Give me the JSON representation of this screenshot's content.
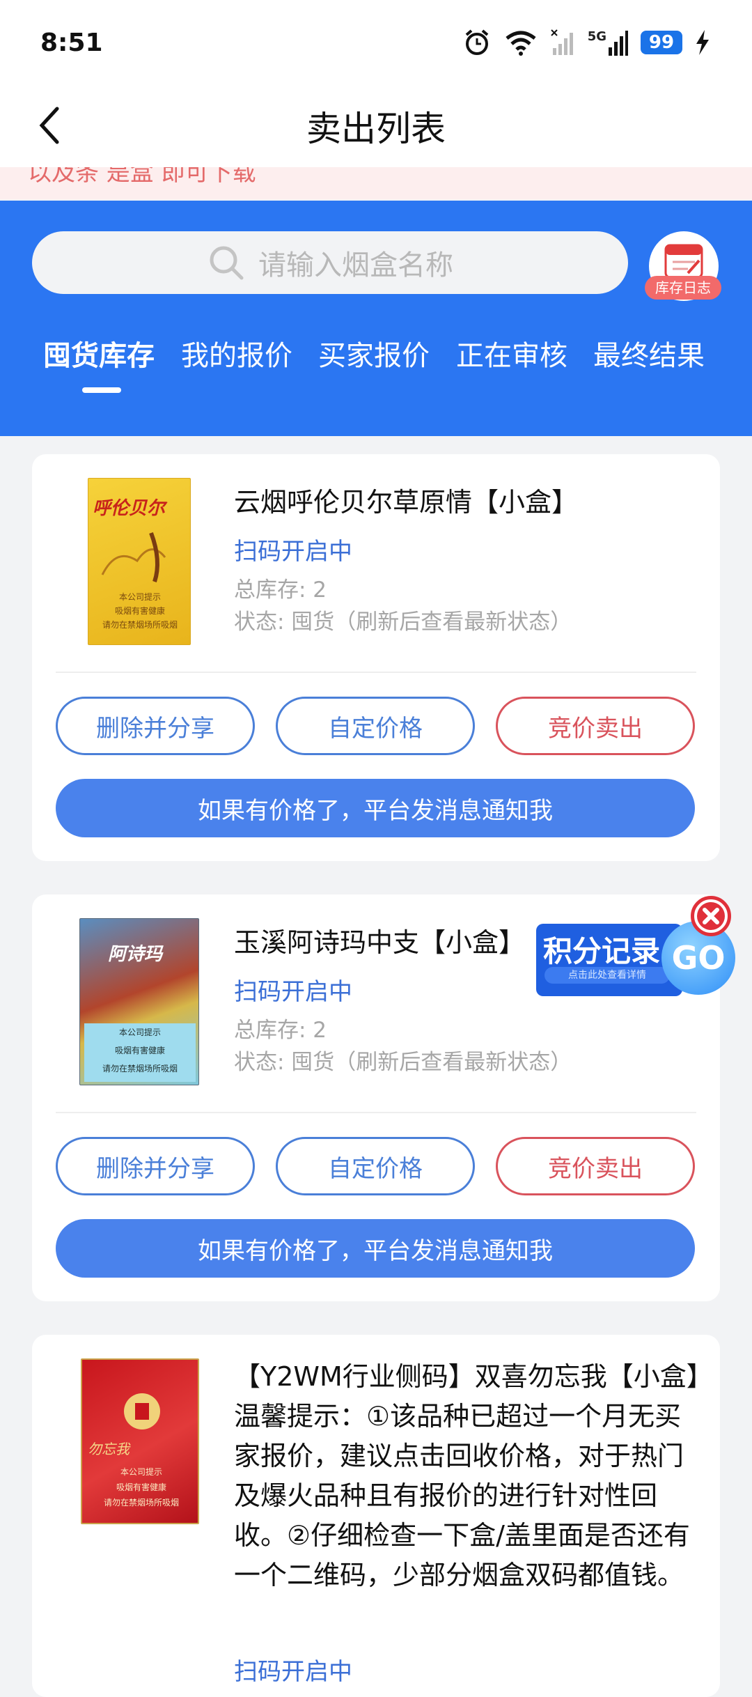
{
  "status_bar": {
    "time": "8:51",
    "battery": "99",
    "network": "5G"
  },
  "nav": {
    "title": "卖出列表"
  },
  "notice": {
    "text": "以及条 是盒 即可下载"
  },
  "search": {
    "placeholder": "请输入烟盒名称"
  },
  "stock_log": {
    "label": "库存日志"
  },
  "tabs": [
    "囤货库存",
    "我的报价",
    "买家报价",
    "正在审核",
    "最终结果"
  ],
  "cards": [
    {
      "name": "云烟呼伦贝尔草原情【小盒】",
      "scan_status": "扫码开启中",
      "total_stock": "总库存: 2",
      "state": "状态: 囤货（刷新后查看最新状态）",
      "btn_delete": "删除并分享",
      "btn_custom": "自定价格",
      "btn_bid": "竞价卖出",
      "btn_notify": "如果有价格了，平台发消息通知我",
      "box_brand": "呼伦贝尔",
      "box_warning": [
        "本公司提示",
        "吸烟有害健康",
        "请勿在禁烟场所吸烟"
      ]
    },
    {
      "name": "玉溪阿诗玛中支【小盒】",
      "scan_status": "扫码开启中",
      "total_stock": "总库存: 2",
      "state": "状态: 囤货（刷新后查看最新状态）",
      "btn_delete": "删除并分享",
      "btn_custom": "自定价格",
      "btn_bid": "竞价卖出",
      "btn_notify": "如果有价格了，平台发消息通知我",
      "box_brand": "阿诗玛",
      "box_warning": [
        "本公司提示",
        "吸烟有害健康",
        "请勿在禁烟场所吸烟"
      ]
    },
    {
      "name": "【Y2WM行业侧码】双喜勿忘我【小盒】温馨提示：①该品种已超过一个月无买家报价，建议点击回收价格，对于热门及爆火品种且有报价的进行针对性回收。②仔细检查一下盒/盖里面是否还有一个二维码，少部分烟盒双码都值钱。",
      "scan_status": "扫码开启中",
      "box_brand": "勿忘我",
      "box_warning": [
        "本公司提示",
        "吸烟有害健康",
        "请勿在禁烟场所吸烟"
      ]
    }
  ],
  "float_ad": {
    "title": "积分记录",
    "subtitle": "点击此处查看详情",
    "go": "GO"
  },
  "colors": {
    "primary": "#2b76f2",
    "link": "#3b6fd6",
    "danger": "#d9535c"
  }
}
